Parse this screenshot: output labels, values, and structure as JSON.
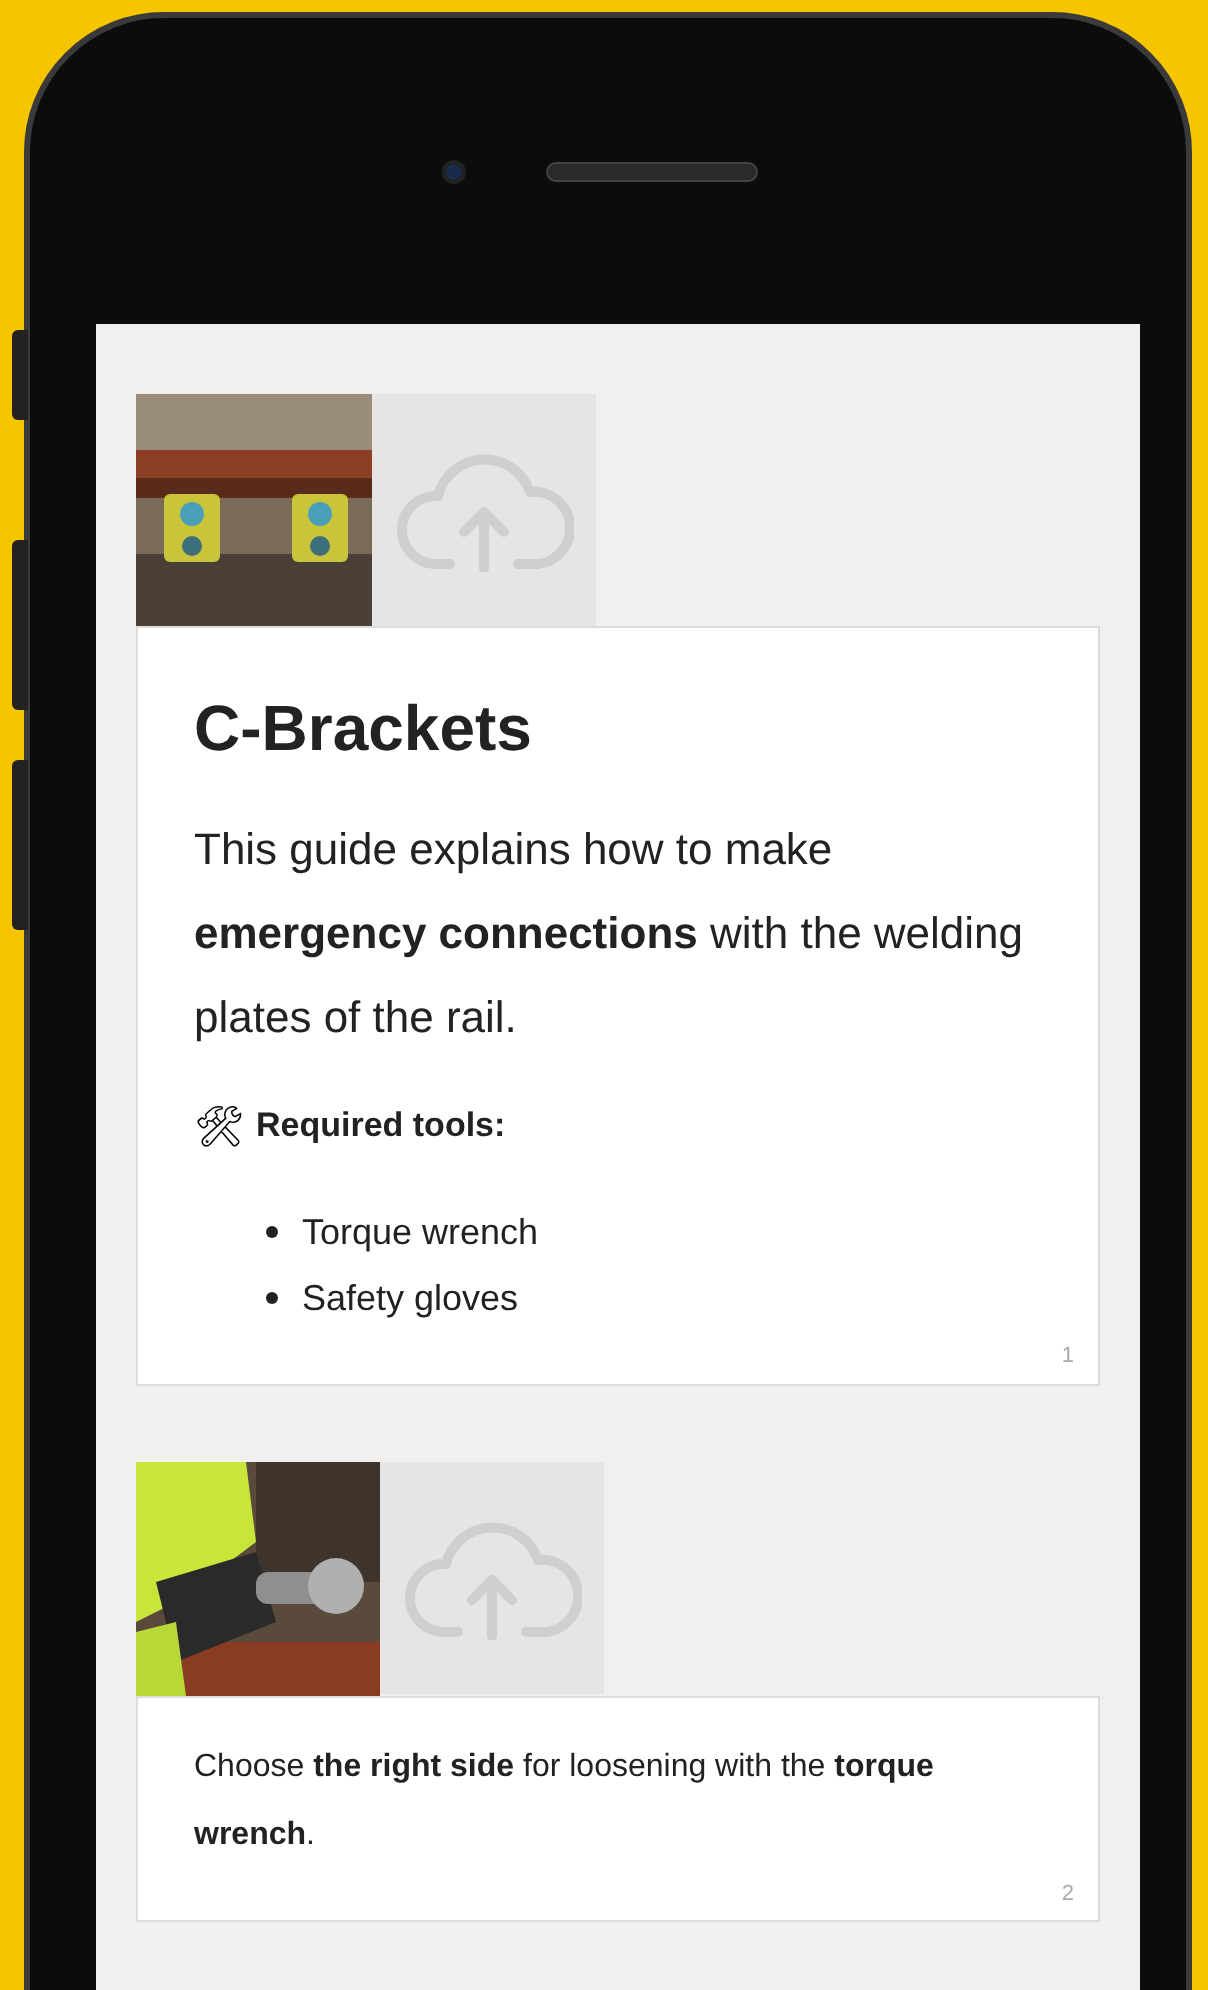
{
  "cards": [
    {
      "kind": "intro",
      "title": "C-Brackets",
      "text": "This guide explains how to make **emergency connections** with the welding plates of the rail.",
      "tools_icon": "🛠",
      "tools_label": "Required tools:",
      "tools": [
        "Torque wrench",
        "Safety gloves"
      ],
      "page": "1"
    },
    {
      "kind": "step",
      "text": "Choose **the right side** for loosening with the **torque wrench**.",
      "page": "2"
    }
  ]
}
